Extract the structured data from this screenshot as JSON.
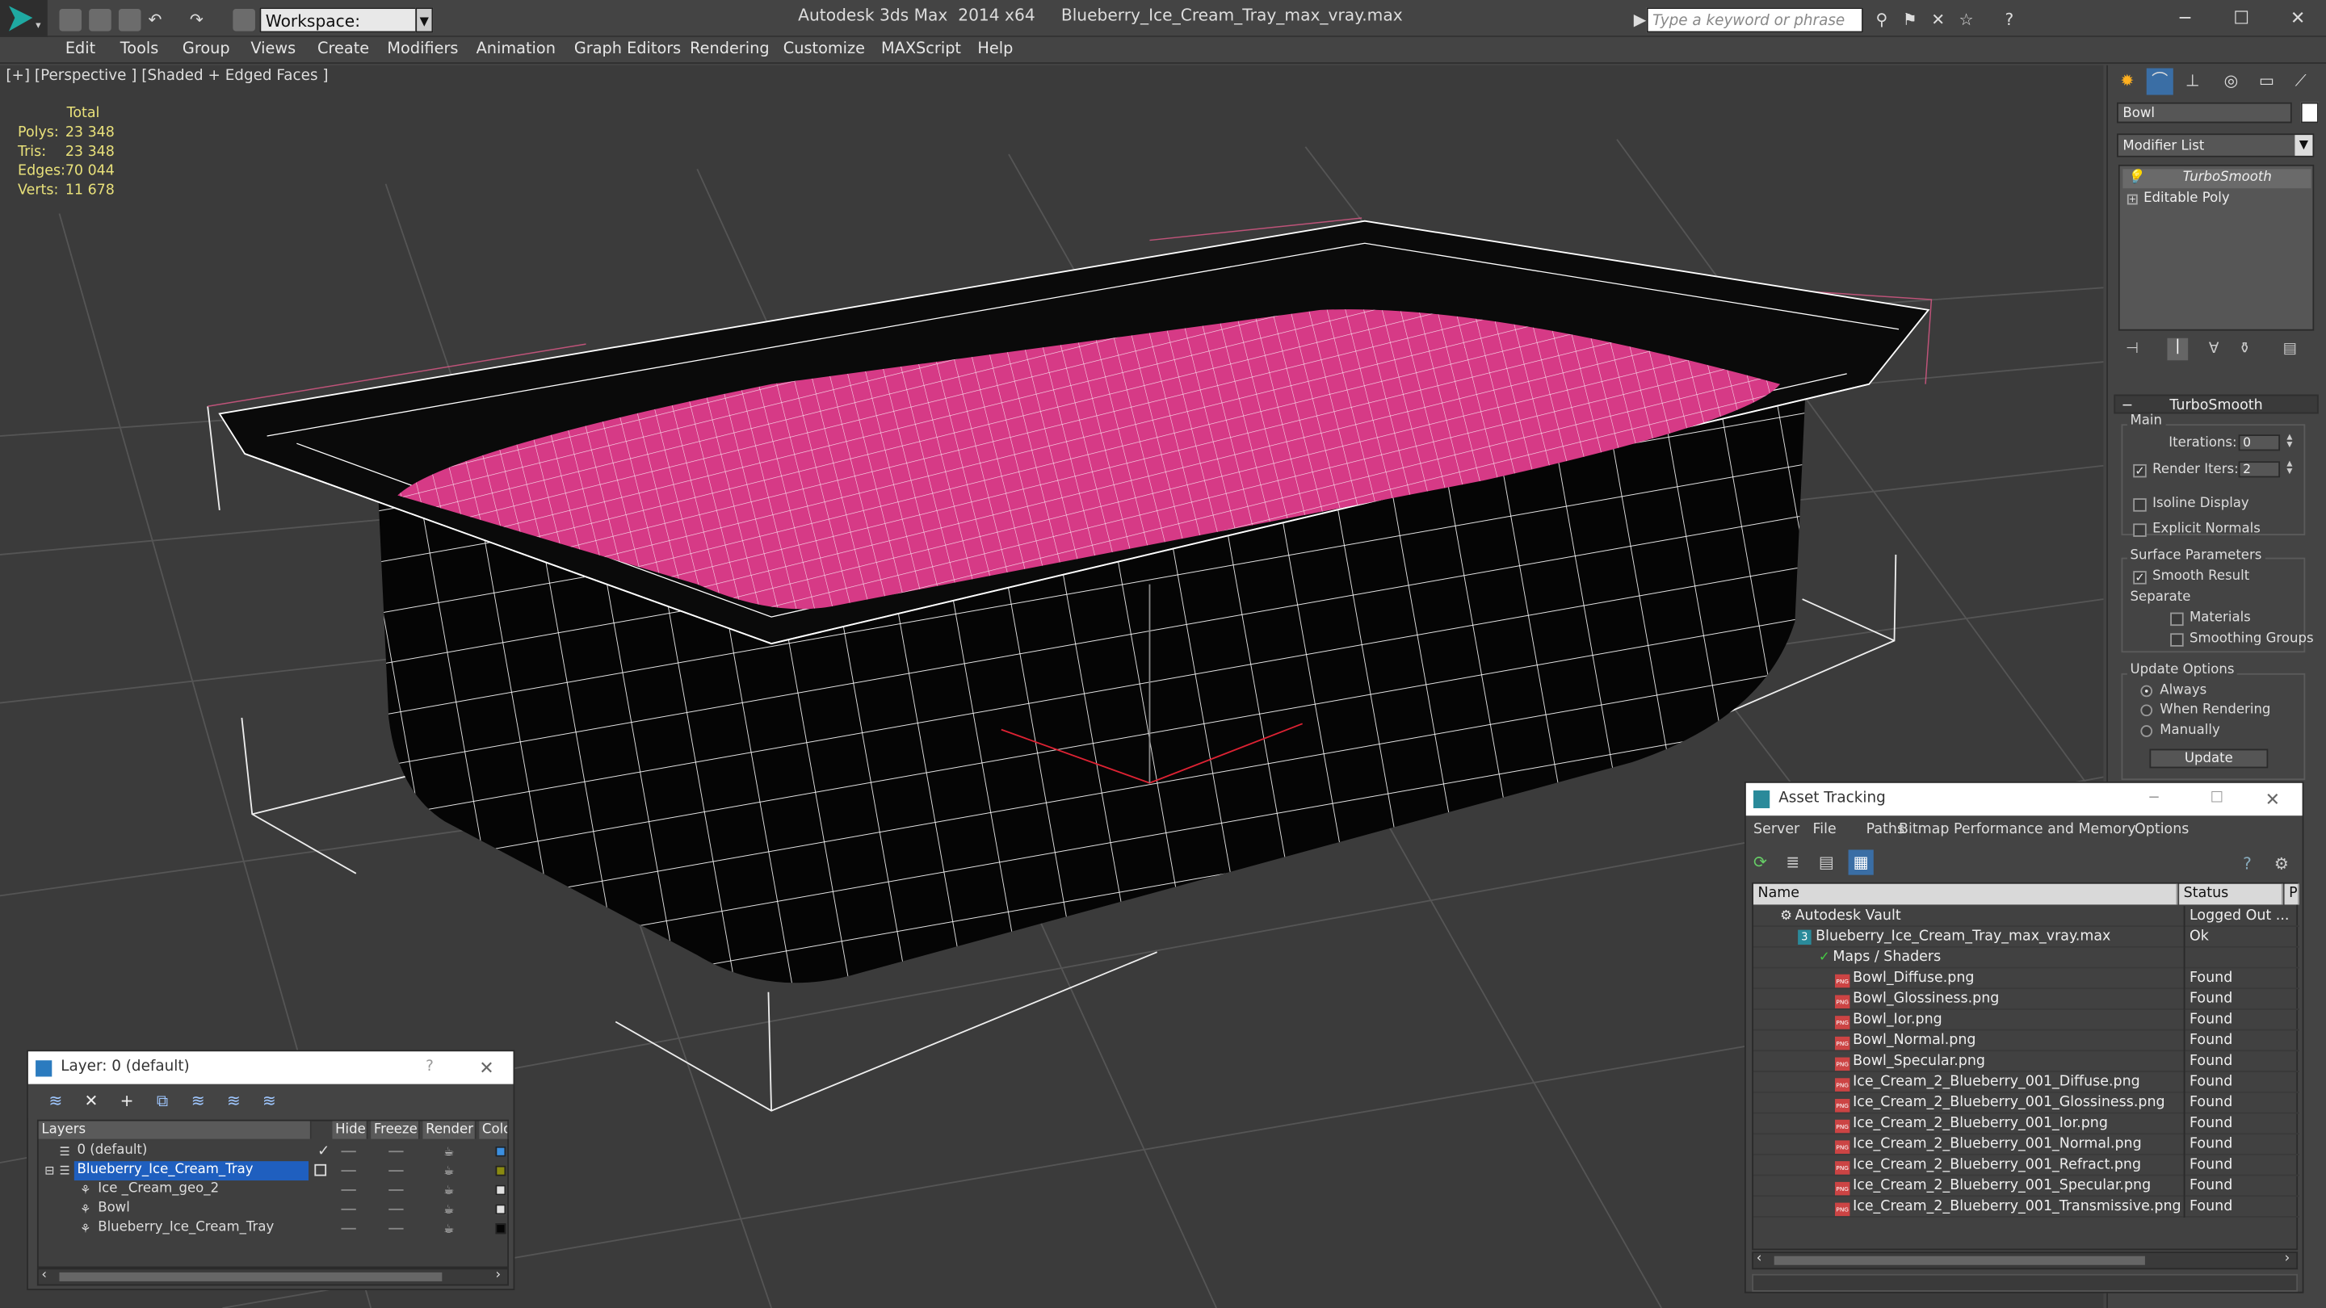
{
  "titlebar": {
    "app": "Autodesk 3ds Max  2014 x64",
    "file": "Blueberry_Ice_Cream_Tray_max_vray.max",
    "workspace": "Workspace: Default",
    "search_placeholder": "Type a keyword or phrase"
  },
  "menu": [
    "Edit",
    "Tools",
    "Group",
    "Views",
    "Create",
    "Modifiers",
    "Animation",
    "Graph Editors",
    "Rendering",
    "Customize",
    "MAXScript",
    "Help"
  ],
  "viewport": {
    "label": "[+] [Perspective ] [Shaded + Edged Faces ]",
    "stats": {
      "header": "Total",
      "rows": [
        {
          "label": "Polys:",
          "value": "23 348"
        },
        {
          "label": "Tris:",
          "value": "23 348"
        },
        {
          "label": "Edges:",
          "value": "70 044"
        },
        {
          "label": "Verts:",
          "value": "11 678"
        }
      ]
    },
    "colors": {
      "background": "#3b3b3b",
      "surface": "#d63a86",
      "body": "#050505",
      "wire": "#ffffff"
    }
  },
  "command_panel": {
    "object_name": "Bowl",
    "modifier_list": "Modifier List",
    "stack": [
      "TurboSmooth",
      "Editable Poly"
    ],
    "rollout_title": "TurboSmooth",
    "main_label": "Main",
    "iterations_label": "Iterations:",
    "iterations_value": "0",
    "render_iters_label": "Render Iters:",
    "render_iters_value": "2",
    "isoline": "Isoline Display",
    "explicit_normals": "Explicit Normals",
    "surface_params": "Surface Parameters",
    "smooth_result": "Smooth Result",
    "separate": "Separate",
    "materials": "Materials",
    "smoothing_groups": "Smoothing Groups",
    "update_options": "Update Options",
    "always": "Always",
    "when_rendering": "When Rendering",
    "manually": "Manually",
    "update_button": "Update"
  },
  "layer_explorer": {
    "title": "Layer: 0 (default)",
    "help": "?",
    "columns": [
      "Layers",
      "Hide",
      "Freeze",
      "Render",
      "Colo"
    ],
    "rows": [
      {
        "name": "0 (default)",
        "indent": 0,
        "selected": false,
        "color": "#3b8fe0"
      },
      {
        "name": "Blueberry_Ice_Cream_Tray",
        "indent": 0,
        "selected": true,
        "color": "#8a8a10"
      },
      {
        "name": "Ice _Cream_geo_2",
        "indent": 1,
        "selected": false,
        "color": "#e0e0e0"
      },
      {
        "name": "Bowl",
        "indent": 1,
        "selected": false,
        "color": "#e0e0e0"
      },
      {
        "name": "Blueberry_Ice_Cream_Tray",
        "indent": 1,
        "selected": false,
        "color": "#050505"
      }
    ]
  },
  "asset_tracking": {
    "title": "Asset Tracking",
    "menu": [
      "Server",
      "File",
      "Paths",
      "Bitmap Performance and Memory",
      "Options"
    ],
    "columns": [
      "Name",
      "Status",
      "P"
    ],
    "rows": [
      {
        "name": "Autodesk Vault",
        "indent": 0,
        "status": "Logged Out ...",
        "icon": "vault"
      },
      {
        "name": "Blueberry_Ice_Cream_Tray_max_vray.max",
        "indent": 1,
        "status": "Ok",
        "icon": "max"
      },
      {
        "name": "Maps / Shaders",
        "indent": 2,
        "status": "",
        "icon": "maps"
      },
      {
        "name": "Bowl_Diffuse.png",
        "indent": 3,
        "status": "Found",
        "icon": "png"
      },
      {
        "name": "Bowl_Glossiness.png",
        "indent": 3,
        "status": "Found",
        "icon": "png"
      },
      {
        "name": "Bowl_Ior.png",
        "indent": 3,
        "status": "Found",
        "icon": "png"
      },
      {
        "name": "Bowl_Normal.png",
        "indent": 3,
        "status": "Found",
        "icon": "png"
      },
      {
        "name": "Bowl_Specular.png",
        "indent": 3,
        "status": "Found",
        "icon": "png"
      },
      {
        "name": "Ice_Cream_2_Blueberry_001_Diffuse.png",
        "indent": 3,
        "status": "Found",
        "icon": "png"
      },
      {
        "name": "Ice_Cream_2_Blueberry_001_Glossiness.png",
        "indent": 3,
        "status": "Found",
        "icon": "png"
      },
      {
        "name": "Ice_Cream_2_Blueberry_001_Ior.png",
        "indent": 3,
        "status": "Found",
        "icon": "png"
      },
      {
        "name": "Ice_Cream_2_Blueberry_001_Normal.png",
        "indent": 3,
        "status": "Found",
        "icon": "png"
      },
      {
        "name": "Ice_Cream_2_Blueberry_001_Refract.png",
        "indent": 3,
        "status": "Found",
        "icon": "png"
      },
      {
        "name": "Ice_Cream_2_Blueberry_001_Specular.png",
        "indent": 3,
        "status": "Found",
        "icon": "png"
      },
      {
        "name": "Ice_Cream_2_Blueberry_001_Transmissive.png",
        "indent": 3,
        "status": "Found",
        "icon": "png"
      }
    ]
  }
}
